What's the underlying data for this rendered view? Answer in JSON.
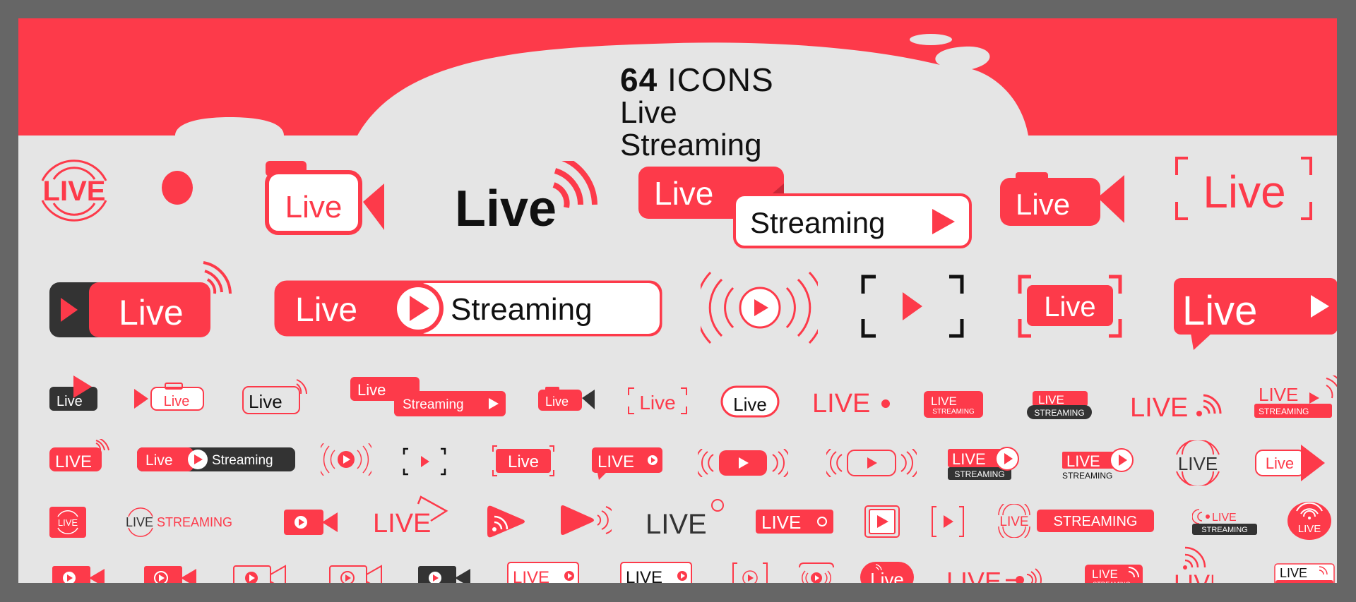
{
  "title": {
    "count": "64",
    "icons_word": "ICONS",
    "line2": "Live",
    "line3": "Streaming"
  },
  "colors": {
    "frame": "#666666",
    "background": "#e5e5e5",
    "accent_red": "#fd3a4a",
    "dark": "#333333",
    "white": "#ffffff",
    "black": "#111111"
  },
  "labels": {
    "live": "Live",
    "live_caps": "LIVE",
    "streaming": "Streaming",
    "streaming_caps": "STREAMING"
  },
  "rows": [
    {
      "row": 1,
      "icons": [
        "live-concentric-circles-caps",
        "red-record-dot",
        "camera-outline-live",
        "live-wifi-black",
        "live-streaming-stacked-play",
        "camera-filled-live",
        "live-viewfinder-brackets"
      ]
    },
    {
      "row": 2,
      "icons": [
        "live-dark-play-wifi",
        "live-play-streaming-pill",
        "broadcast-play-waves",
        "viewfinder-play-black",
        "live-viewfinder-filled",
        "live-speech-bubble-play"
      ]
    },
    {
      "row": 3,
      "icons": [
        "live-dark-play-corner",
        "play-camera-outline-live",
        "live-outline-wifi",
        "live-streaming-stacked-small",
        "camera-filled-live-dark",
        "live-brackets-small",
        "live-oval-outline",
        "live-caps-dot",
        "live-streaming-wifi-box",
        "live-streaming-dark-pill",
        "live-caps-wifi",
        "live-streaming-play-wifi"
      ]
    },
    {
      "row": 4,
      "icons": [
        "live-caps-wifi-box",
        "live-play-streaming-dark",
        "broadcast-play-small",
        "viewfinder-play-small",
        "live-viewfinder-filled-small",
        "live-caps-play-bubble",
        "play-pill-waves-filled",
        "play-pill-waves-outline",
        "live-streaming-dark-play",
        "live-streaming-play-circle",
        "live-concentric-dark",
        "live-arrow-outline"
      ]
    },
    {
      "row": 5,
      "icons": [
        "live-square-concentric",
        "live-streaming-concentric-text",
        "video-camera-play",
        "live-play-arrow-outline",
        "wifi-play-triangle",
        "play-sound-waves",
        "live-record-circle",
        "live-caps-ring",
        "play-square-frame",
        "play-brackets",
        "live-concentric-streaming-pill",
        "live-broadcast-dark-label",
        "live-circle-wifi"
      ]
    },
    {
      "row": 6,
      "icons": [
        "camera-play-filled",
        "camera-play-ring",
        "camera-play-outline",
        "camera-play-outline-ring",
        "camera-play-dark",
        "live-bubble-outline-red",
        "live-bubble-outline-black",
        "play-circle-brackets",
        "broadcast-play-frame",
        "live-pill-wifi-dot",
        "live-line-dot-waves",
        "live-streaming-wifi-box-small",
        "live-wifi-tall",
        "live-streaming-outline-box"
      ]
    }
  ]
}
